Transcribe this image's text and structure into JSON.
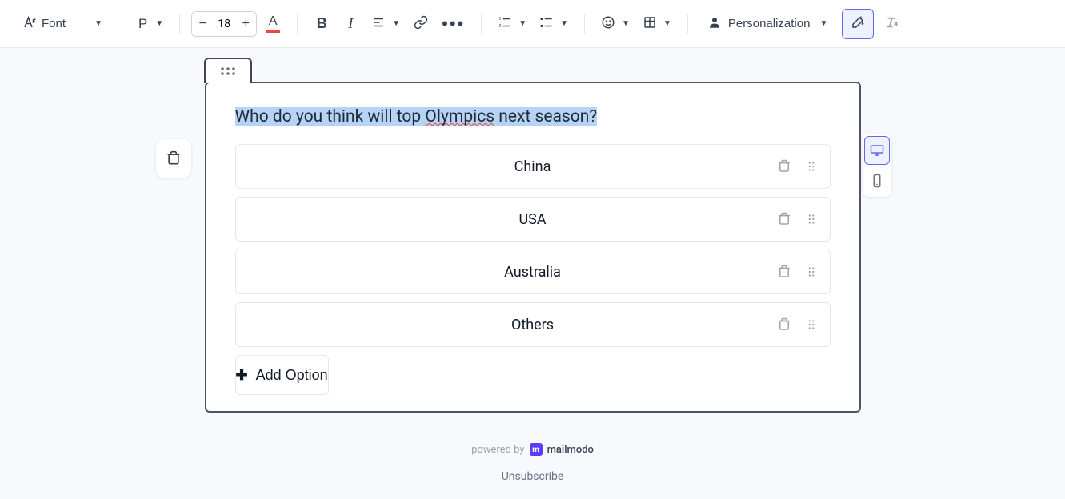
{
  "toolbar": {
    "font_label": "Font",
    "paragraph_label": "P",
    "font_size": "18",
    "personalization_label": "Personalization"
  },
  "block": {
    "question_pre": "Who do you think will top ",
    "question_err": "Olympics",
    "question_post": " next season?",
    "options": [
      "China",
      "USA",
      "Australia",
      "Others"
    ],
    "add_option_label": "Add Option"
  },
  "footer": {
    "powered_by": "powered by",
    "brand": "mailmodo",
    "unsubscribe": "Unsubscribe"
  }
}
